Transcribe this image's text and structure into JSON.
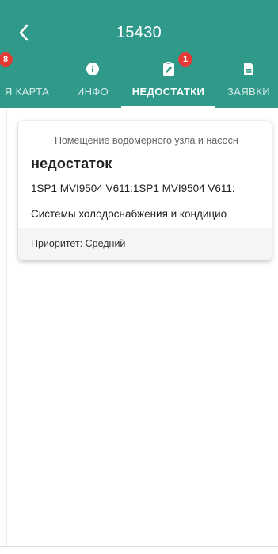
{
  "header": {
    "title": "15430",
    "back_icon": "arrow-left-icon"
  },
  "tabs": [
    {
      "label": "Я КАРТА",
      "badge": "8",
      "icon": "none",
      "active": false
    },
    {
      "label": "ИНФО",
      "icon": "info-icon",
      "active": false
    },
    {
      "label": "НЕДОСТАТКИ",
      "icon": "clipboard-edit-icon",
      "badge": "1",
      "active": true
    },
    {
      "label": "ЗАЯВКИ",
      "icon": "document-icon",
      "active": false
    }
  ],
  "card": {
    "location": "Помещение водомерного узла и насосн",
    "heading": "недостаток",
    "line1": "1SP1 MVI9504 V611:1SP1 MVI9504 V611:",
    "line2": "Системы холодоснабжения и кондицио",
    "priority": "Приоритет: Средний"
  },
  "colors": {
    "header_bg": "#2f9a8a",
    "badge": "#e53935",
    "card_footer": "#f5f5f5"
  }
}
